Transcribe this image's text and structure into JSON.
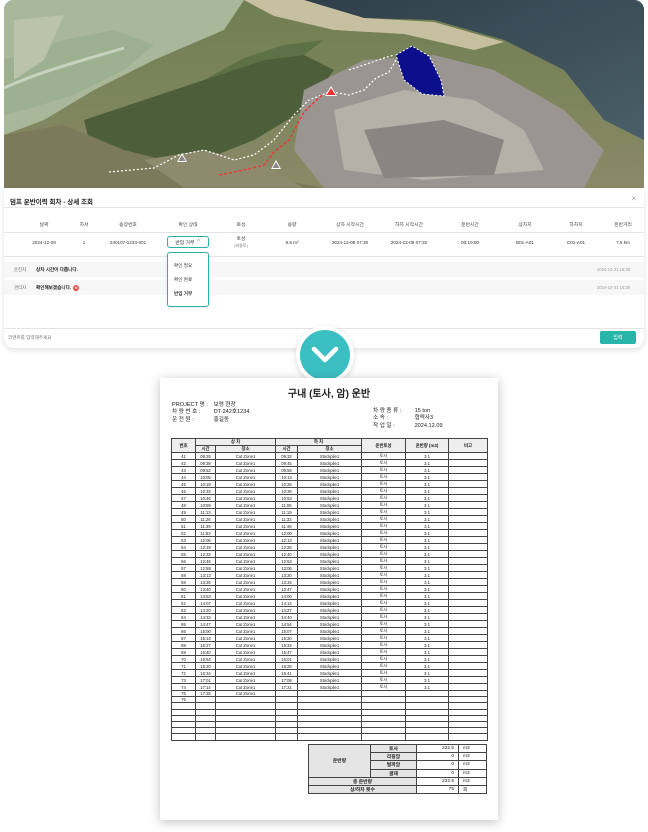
{
  "panel": {
    "title": "덤프 운반이력 회차 - 상세 조회",
    "close": "×",
    "headers": [
      "날짜",
      "차서",
      "송장번호",
      "확인 상태",
      "토성",
      "용량",
      "상차 시작시간",
      "하차 시작시간",
      "운반시간",
      "상차지",
      "하차지",
      "운반거리"
    ],
    "row": {
      "date": "2024-12-09",
      "seq": "1",
      "invoice": "240107-1234-001",
      "status": "반입 거부",
      "soil": "토성",
      "soil_sub": "(비용토)",
      "volume": "9.5 m³",
      "load_start": "2024-12-09 07:30",
      "unload_start": "2024-12-09 07:30",
      "duration": "00:10:00",
      "load_site": "B01-A01",
      "unload_site": "C01-A01",
      "distance": "7.5 km"
    },
    "status_options": [
      "확인 필요",
      "확인 완료",
      "반입 거부"
    ],
    "comments": [
      {
        "who": "운전자",
        "msg": "상차 시간이 다릅니다.",
        "time": "2024-10-31 15:39",
        "badge": ""
      },
      {
        "who": "관리자",
        "msg": "확인해보겠습니다.",
        "time": "2024-10-31 15:39",
        "badge": "N"
      }
    ],
    "comment_placeholder": "코멘트를 입력해주세요",
    "submit_label": "입력"
  },
  "doc": {
    "title": "구내 (토사, 암) 운반",
    "project_label": "PROJECT 명 :",
    "project_value": "보령 현장",
    "vehicle_label": "차 량 번 호 :",
    "vehicle_value": "DT-242호1234",
    "driver_label": "운 전 원 :",
    "driver_value": "홍길동",
    "type_label": "차 량 종 류 :",
    "type_value": "15 ton",
    "org_label": "소        속 :",
    "org_value": "협력사3",
    "workday_label": "작  업  일 :",
    "workday_value": "2024.12.09",
    "col_no": "번호",
    "col_load": "상 차",
    "col_unload": "하 차",
    "col_soil": "운반토성",
    "col_volume": "운반량 (m3)",
    "col_note": "비고",
    "col_time": "시간",
    "col_place": "장소",
    "rows": [
      [
        "41",
        "09:25",
        "Cut Zone1",
        "09:32",
        "Stockpile1",
        "토사",
        "3.1"
      ],
      [
        "42",
        "09:38",
        "Cut Zone1",
        "09:45",
        "Stockpile1",
        "토사",
        "3.1"
      ],
      [
        "43",
        "09:52",
        "Cut Zone1",
        "09:59",
        "Stockpile1",
        "토사",
        "3.1"
      ],
      [
        "44",
        "10:05",
        "Cut Zone1",
        "10:13",
        "Stockpile1",
        "토사",
        "3.1"
      ],
      [
        "45",
        "10:19",
        "Cut Zone1",
        "10:26",
        "Stockpile1",
        "토사",
        "3.1"
      ],
      [
        "46",
        "10:33",
        "Cut Zone1",
        "10:39",
        "Stockpile1",
        "토사",
        "3.1"
      ],
      [
        "47",
        "10:46",
        "Cut Zone1",
        "10:53",
        "Stockpile1",
        "토사",
        "3.1"
      ],
      [
        "48",
        "10:59",
        "Cut Zone1",
        "11:06",
        "Stockpile1",
        "토사",
        "3.1"
      ],
      [
        "49",
        "11:13",
        "Cut Zone1",
        "11:19",
        "Stockpile1",
        "토사",
        "3.1"
      ],
      [
        "50",
        "11:26",
        "Cut Zone1",
        "11:33",
        "Stockpile1",
        "토사",
        "3.1"
      ],
      [
        "51",
        "11:39",
        "Cut Zone1",
        "11:46",
        "Stockpile1",
        "토사",
        "3.1"
      ],
      [
        "52",
        "11:53",
        "Cut Zone1",
        "12:00",
        "Stockpile1",
        "토사",
        "3.1"
      ],
      [
        "53",
        "12:06",
        "Cut Zone1",
        "12:13",
        "Stockpile1",
        "토사",
        "3.1"
      ],
      [
        "54",
        "12:19",
        "Cut Zone1",
        "12:26",
        "Stockpile1",
        "토사",
        "3.1"
      ],
      [
        "55",
        "12:33",
        "Cut Zone1",
        "12:40",
        "Stockpile1",
        "토사",
        "3.1"
      ],
      [
        "56",
        "12:46",
        "Cut Zone1",
        "12:53",
        "Stockpile1",
        "토사",
        "3.1"
      ],
      [
        "57",
        "12:59",
        "Cut Zone1",
        "13:06",
        "Stockpile1",
        "토사",
        "3.1"
      ],
      [
        "58",
        "13:13",
        "Cut Zone1",
        "13:20",
        "Stockpile1",
        "토사",
        "3.1"
      ],
      [
        "59",
        "13:26",
        "Cut Zone1",
        "13:34",
        "Stockpile1",
        "토사",
        "3.1"
      ],
      [
        "60",
        "13:40",
        "Cut Zone1",
        "13:47",
        "Stockpile1",
        "토사",
        "3.1"
      ],
      [
        "61",
        "13:53",
        "Cut Zone1",
        "14:00",
        "Stockpile1",
        "토사",
        "3.1"
      ],
      [
        "62",
        "14:07",
        "Cut Zone1",
        "14:14",
        "Stockpile1",
        "토사",
        "3.1"
      ],
      [
        "63",
        "14:20",
        "Cut Zone1",
        "14:27",
        "Stockpile1",
        "토사",
        "3.1"
      ],
      [
        "64",
        "14:33",
        "Cut Zone1",
        "14:40",
        "Stockpile1",
        "토사",
        "3.1"
      ],
      [
        "65",
        "14:47",
        "Cut Zone1",
        "14:54",
        "Stockpile1",
        "토사",
        "3.1"
      ],
      [
        "66",
        "15:00",
        "Cut Zone1",
        "15:07",
        "Stockpile1",
        "토사",
        "3.1"
      ],
      [
        "67",
        "15:14",
        "Cut Zone1",
        "15:20",
        "Stockpile1",
        "토사",
        "3.1"
      ],
      [
        "68",
        "15:27",
        "Cut Zone1",
        "15:34",
        "Stockpile1",
        "토사",
        "3.1"
      ],
      [
        "69",
        "15:40",
        "Cut Zone1",
        "15:47",
        "Stockpile1",
        "토사",
        "3.1"
      ],
      [
        "70",
        "15:54",
        "Cut Zone1",
        "16:01",
        "Stockpile1",
        "토사",
        "3.1"
      ],
      [
        "71",
        "16:20",
        "Cut Zone1",
        "16:28",
        "Stockpile1",
        "토사",
        "3.1"
      ],
      [
        "72",
        "16:34",
        "Cut Zone1",
        "16:41",
        "Stockpile1",
        "토사",
        "3.1"
      ],
      [
        "73",
        "17:01",
        "Cut Zone1",
        "17:08",
        "Stockpile1",
        "토사",
        "3.1"
      ],
      [
        "74",
        "17:14",
        "Cut Zone1",
        "17:21",
        "Stockpile1",
        "토사",
        "3.1"
      ],
      [
        "75",
        "17:28",
        "Cut Zone1",
        "",
        "",
        "",
        ""
      ],
      [
        "76",
        "",
        "",
        "",
        "",
        "",
        ""
      ],
      [
        "",
        "",
        "",
        "",
        "",
        "",
        ""
      ],
      [
        "",
        "",
        "",
        "",
        "",
        "",
        ""
      ],
      [
        "",
        "",
        "",
        "",
        "",
        "",
        ""
      ],
      [
        "",
        "",
        "",
        "",
        "",
        "",
        ""
      ],
      [
        "",
        "",
        "",
        "",
        "",
        "",
        ""
      ],
      [
        "",
        "",
        "",
        "",
        "",
        "",
        ""
      ]
    ],
    "summary_group": "운반량",
    "summary": [
      {
        "label": "토사",
        "value": "232.5",
        "unit": "m3"
      },
      {
        "label": "리핑암",
        "value": "0",
        "unit": "m3"
      },
      {
        "label": "발파암",
        "value": "0",
        "unit": "m3"
      },
      {
        "label": "골재",
        "value": "0",
        "unit": "m3"
      }
    ],
    "total_label": "총 운반량",
    "total_value": "232.5",
    "total_unit": "m3",
    "trips_label": "상/하차 횟수",
    "trips_value": "75",
    "trips_unit": "회"
  }
}
